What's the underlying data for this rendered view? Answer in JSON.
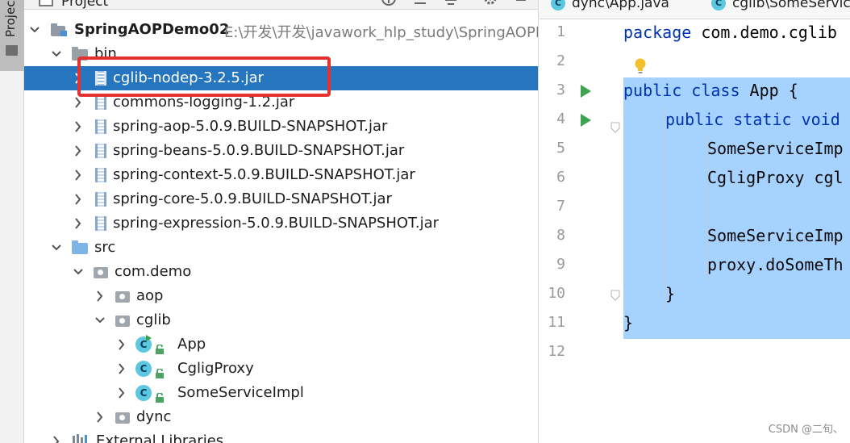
{
  "toolstrip": {
    "tab_label": "Projec"
  },
  "project_panel": {
    "title": "Project",
    "tree": [
      {
        "label": "SpringAOPDemo02",
        "path": "E:\\开发\\开发\\javawork_hlp_study\\SpringAOPD",
        "type": "module",
        "indent": 0,
        "expanded": true
      },
      {
        "label": "bin",
        "type": "folder-gray",
        "indent": 1,
        "expanded": true
      },
      {
        "label": "cglib-nodep-3.2.5.jar",
        "type": "jar",
        "indent": 2,
        "expanded": false,
        "selected": true
      },
      {
        "label": "commons-logging-1.2.jar",
        "type": "jar",
        "indent": 2,
        "expanded": false
      },
      {
        "label": "spring-aop-5.0.9.BUILD-SNAPSHOT.jar",
        "type": "jar",
        "indent": 2,
        "expanded": false
      },
      {
        "label": "spring-beans-5.0.9.BUILD-SNAPSHOT.jar",
        "type": "jar",
        "indent": 2,
        "expanded": false
      },
      {
        "label": "spring-context-5.0.9.BUILD-SNAPSHOT.jar",
        "type": "jar",
        "indent": 2,
        "expanded": false
      },
      {
        "label": "spring-core-5.0.9.BUILD-SNAPSHOT.jar",
        "type": "jar",
        "indent": 2,
        "expanded": false
      },
      {
        "label": "spring-expression-5.0.9.BUILD-SNAPSHOT.jar",
        "type": "jar",
        "indent": 2,
        "expanded": false
      },
      {
        "label": "src",
        "type": "folder-blue",
        "indent": 1,
        "expanded": true
      },
      {
        "label": "com.demo",
        "type": "package",
        "indent": 2,
        "expanded": true
      },
      {
        "label": "aop",
        "type": "package",
        "indent": 3,
        "expanded": false
      },
      {
        "label": "cglib",
        "type": "package",
        "indent": 3,
        "expanded": true
      },
      {
        "label": "App",
        "type": "class-run",
        "indent": 4,
        "expanded": false
      },
      {
        "label": "CgligProxy",
        "type": "class",
        "indent": 4,
        "expanded": false
      },
      {
        "label": "SomeServiceImpl",
        "type": "class",
        "indent": 4,
        "expanded": false
      },
      {
        "label": "dync",
        "type": "package",
        "indent": 3,
        "expanded": false
      },
      {
        "label": "External Libraries",
        "type": "libs",
        "indent": 1,
        "expanded": false
      }
    ]
  },
  "editor": {
    "tabs": [
      {
        "label": "dync\\App.java"
      },
      {
        "label": "cglib\\SomeServic"
      }
    ],
    "line_numbers": [
      "1",
      "2",
      "3",
      "4",
      "5",
      "6",
      "7",
      "8",
      "9",
      "10",
      "11",
      "12"
    ],
    "lines": [
      {
        "kw": "package",
        "rest": " com.demo.cglib",
        "indent": 0
      },
      {
        "kw": "",
        "rest": "",
        "indent": 0
      },
      {
        "kw": "public class",
        "rest": " App {",
        "indent": 0
      },
      {
        "kw": "public static",
        "rest": " void",
        "kw2": "",
        "indent": 1
      },
      {
        "kw": "",
        "rest": "SomeServiceImp",
        "indent": 2
      },
      {
        "kw": "",
        "rest": "CgligProxy cgl",
        "indent": 2
      },
      {
        "kw": "",
        "rest": "",
        "indent": 0
      },
      {
        "kw": "",
        "rest": "SomeServiceImp",
        "indent": 2
      },
      {
        "kw": "",
        "rest": "proxy.doSomeTh",
        "indent": 2
      },
      {
        "kw": "",
        "rest": "}",
        "indent": 1
      },
      {
        "kw": "",
        "rest": "}",
        "indent": 0
      },
      {
        "kw": "",
        "rest": "",
        "indent": 0
      }
    ],
    "run_lines": [
      3,
      4
    ],
    "selected_lines": [
      3,
      11
    ]
  },
  "watermark": "CSDN @二旬、",
  "colors": {
    "selection": "#2675bf",
    "highlight_box": "#e53030",
    "code_selection": "#a6d2ff",
    "keyword": "#0033b3"
  }
}
